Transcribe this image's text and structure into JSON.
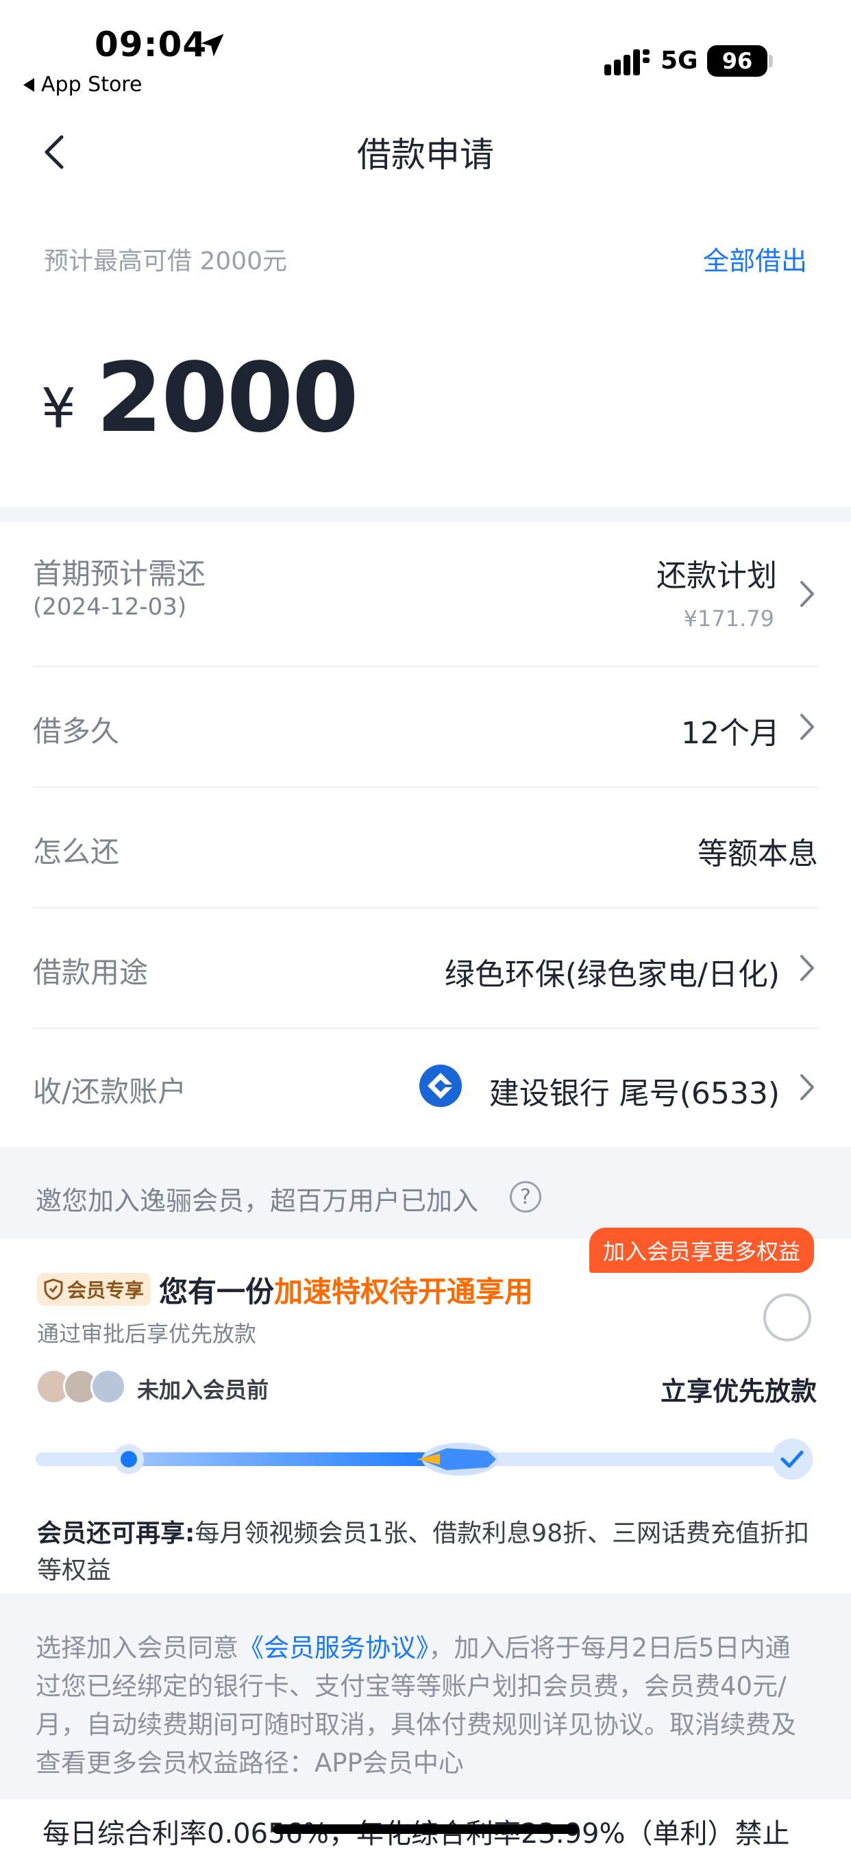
{
  "status_bar": {
    "time": "09:04",
    "back_app": "App Store",
    "network": "5G",
    "battery": "96"
  },
  "nav": {
    "title": "借款申请"
  },
  "amount": {
    "limit_text": "预计最高可借 2000元",
    "borrow_all": "全部借出",
    "currency": "¥",
    "value": "2000"
  },
  "rows": {
    "first_repay": {
      "label": "首期预计需还",
      "date": "(2024-12-03)",
      "value": "还款计划",
      "amount": "¥171.79"
    },
    "term": {
      "label": "借多久",
      "value": "12个月"
    },
    "method": {
      "label": "怎么还",
      "value": "等额本息"
    },
    "purpose": {
      "label": "借款用途",
      "value": "绿色环保(绿色家电/日化)"
    },
    "account": {
      "label": "收/还款账户",
      "value": "建设银行 尾号(6533)"
    }
  },
  "invite": {
    "text": "邀您加入逸骊会员，超百万用户已加入",
    "help": "?"
  },
  "member": {
    "promo_badge": "加入会员享更多权益",
    "tag": "会员专享",
    "headline_prefix": "您有一份",
    "headline_highlight": "加速特权待开通享用",
    "sub_line": "通过审批后享优先放款",
    "before_label": "未加入会员前",
    "after_label": "立享优先放款",
    "benefits_title": "会员还可再享:",
    "benefits_text": "每月领视频会员1张、借款利息98折、三网话费充值折扣等权益"
  },
  "agreement": {
    "prefix": "选择加入会员同意",
    "link": "《会员服务协议》",
    "suffix": "，加入后将于每月2日后5日内通过您已经绑定的银行卡、支付宝等等账户划扣会员费，会员费40元/月，自动续费期间可随时取消，具体付费规则详见协议。取消续费及查看更多会员权益路径：APP会员中心",
    "rate_line": "每日综合利率0.0656%，年化综合利率23.99%（单利）禁止"
  },
  "colors": {
    "accent": "#1677ff",
    "highlight": "#ff6a00",
    "badge": "#ff5a2a"
  }
}
